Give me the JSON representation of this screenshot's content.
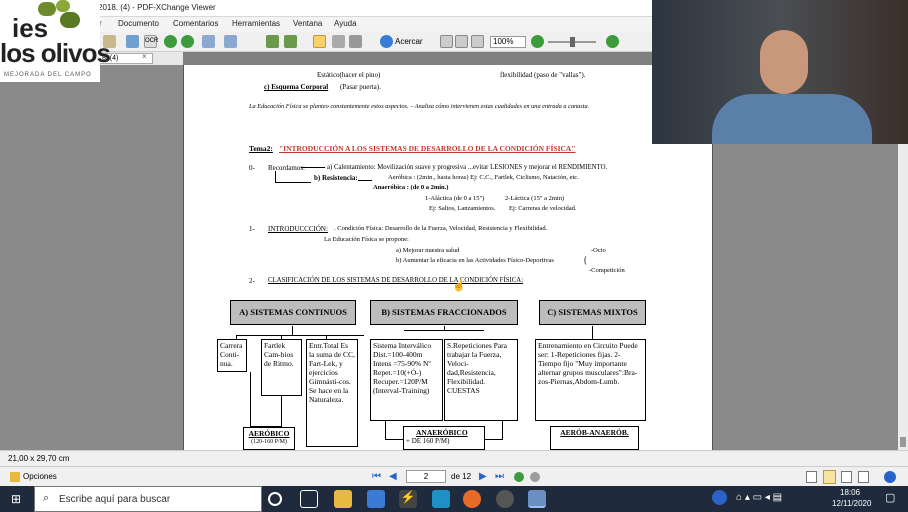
{
  "window": {
    "title": "2018. (4) - PDF-XChange Viewer",
    "tab_label": "8. (4)",
    "tab_close": "×"
  },
  "menu": [
    "r",
    "Documento",
    "Comentarios",
    "Herramientas",
    "Ventana",
    "Ayuda"
  ],
  "toolbar": {
    "zoom_label": "Acercar",
    "zoom_value": "100%"
  },
  "logo": {
    "line1": "ies",
    "line2": "los olivos",
    "tagline": "MEJORADA DEL CAMPO"
  },
  "document": {
    "top_lines": [
      "Estático(hacer el pino)",
      "flexibilidad (paso de \"vallas\").",
      "c) Esquema Corporal",
      "(Pasar puerta).",
      "La Educación Física se planteo constantemente estos aspectos. – Analiza cómo intervienen estas cualidades en una entrada a canasta."
    ],
    "tema_label": "Tema2:",
    "tema_title": "\"INTRODUCCIÓN A LOS SISTEMAS DE DESARROLLO DE LA CONDICIÓN FÍSICA\"",
    "s0_num": "0-",
    "s0_recordamos": "Recordamos:",
    "s0_a": "a) Calentamiento: Movilización suave y progresiva ...evitar LESIONES y mejorar el RENDIMIENTO.",
    "s0_b": "b) Resistencia:",
    "s0_aerobica": "Aeróbica : (2min., hasta horas) Ej: C.C., Fartlek, Ciclismo, Natación, etc.",
    "s0_anaerobica": "Anaeróbica : (de 0 a 2min.)",
    "s0_alactica": "1-Aláctica (de 0 a 15\")",
    "s0_lactica": "2-Láctica (15\" a 2min)",
    "s0_ej1": "Ej: Saltos, Lanzamientos.",
    "s0_ej2": "Ej: Carreras de velocidad.",
    "s1_num": "1-",
    "s1_head": "INTRODUCCCIÓN:",
    "s1_text": ". Condición Física: Desarrollo de la Fuerza, Velocidad, Resistencia y Flexibilidad.",
    "s1_propone": "La Educación Física se propone:",
    "s1_a": "a) Mejorar nuestra salud",
    "s1_b": "b) Aumentar la eficacia en las Actividades Físico-Deportivas",
    "s1_ocio": "-Ocio",
    "s1_comp": "-Competición",
    "s2_num": "2-",
    "s2_head": "CLASIFICACIÓN DE LOS SISTEMAS DE DESARROLLO DE LA CONDICIÓN FÍSICA:",
    "h_cont": "A) SISTEMAS CONTINUOS",
    "h_frac": "B) SISTEMAS FRACCIONADOS",
    "h_mix": "C) SISTEMAS MIXTOS",
    "b_carrera": "Carrera Conti-nua.",
    "b_fartlek": "Fartlek Cam-bios de Ritmo.",
    "b_entr": "Entr.Total Es la suma de CC, Fart-Lek, y ejercicios Gimnásti-cos. Se hace en la Naturaleza.",
    "b_int": "Sistema Interválico Dist.=100-400m Intens =75-90% Nº Repet.=10(+Ó-) Recuper.=120P/M (Interval-Training)",
    "b_rep": "S.Repeticiones Para trabajar la Fuerza, Veloci-dad,Resistencia, Flexibilidad. CUESTAS",
    "b_circ": "Entrenamiento en Circuito Puede ser: 1-Repeticiones fijas. 2-Tiempo fijo \"Muy importante alternar grupos musculares\":Bra-zos-Piernas,Abdom-Lumb.",
    "f_aer": "AERÓBICO",
    "f_aer_sub": "(120-160 P/M)",
    "f_anaer": "ANAERÓBICO",
    "f_anaer_sub": "+ DE 160 P/M)",
    "f_mix": "AERÓB-ANAERÓB."
  },
  "status": {
    "page_size": "21,00 x 29,70 cm"
  },
  "bottom": {
    "options": "Opciones",
    "page_current": "2",
    "page_total": "de 12"
  },
  "taskbar": {
    "search_placeholder": "Escribe aquí para buscar",
    "time": "18:06",
    "date": "12/11/2020"
  }
}
